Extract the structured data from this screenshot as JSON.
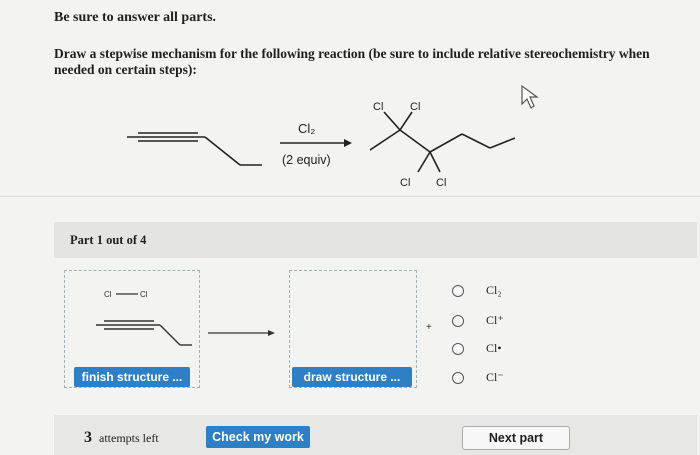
{
  "header": {
    "instruction": "Be sure to answer all parts.",
    "question": "Draw a stepwise mechanism for the following reaction (be sure to include relative stereochemistry when needed on certain steps):"
  },
  "reaction": {
    "reagent": "Cl₂",
    "conditions": "(2 equiv)",
    "product_labels": [
      "Cl",
      "Cl",
      "Cl",
      "Cl"
    ]
  },
  "part": {
    "label": "Part 1 out of 4"
  },
  "workspace": {
    "left_box": {
      "bond_label_a": "Cl",
      "bond_label_b": "Cl",
      "button": "finish structure ..."
    },
    "right_box": {
      "button": "draw structure ..."
    },
    "plus": "+"
  },
  "options": [
    {
      "label": "Cl₂"
    },
    {
      "label": "Cl⁺"
    },
    {
      "label": "Cl•"
    },
    {
      "label": "Cl⁻"
    }
  ],
  "footer": {
    "attempts_num": "3",
    "attempts_text": "attempts left",
    "check_button": "Check my work",
    "next_button": "Next part"
  }
}
